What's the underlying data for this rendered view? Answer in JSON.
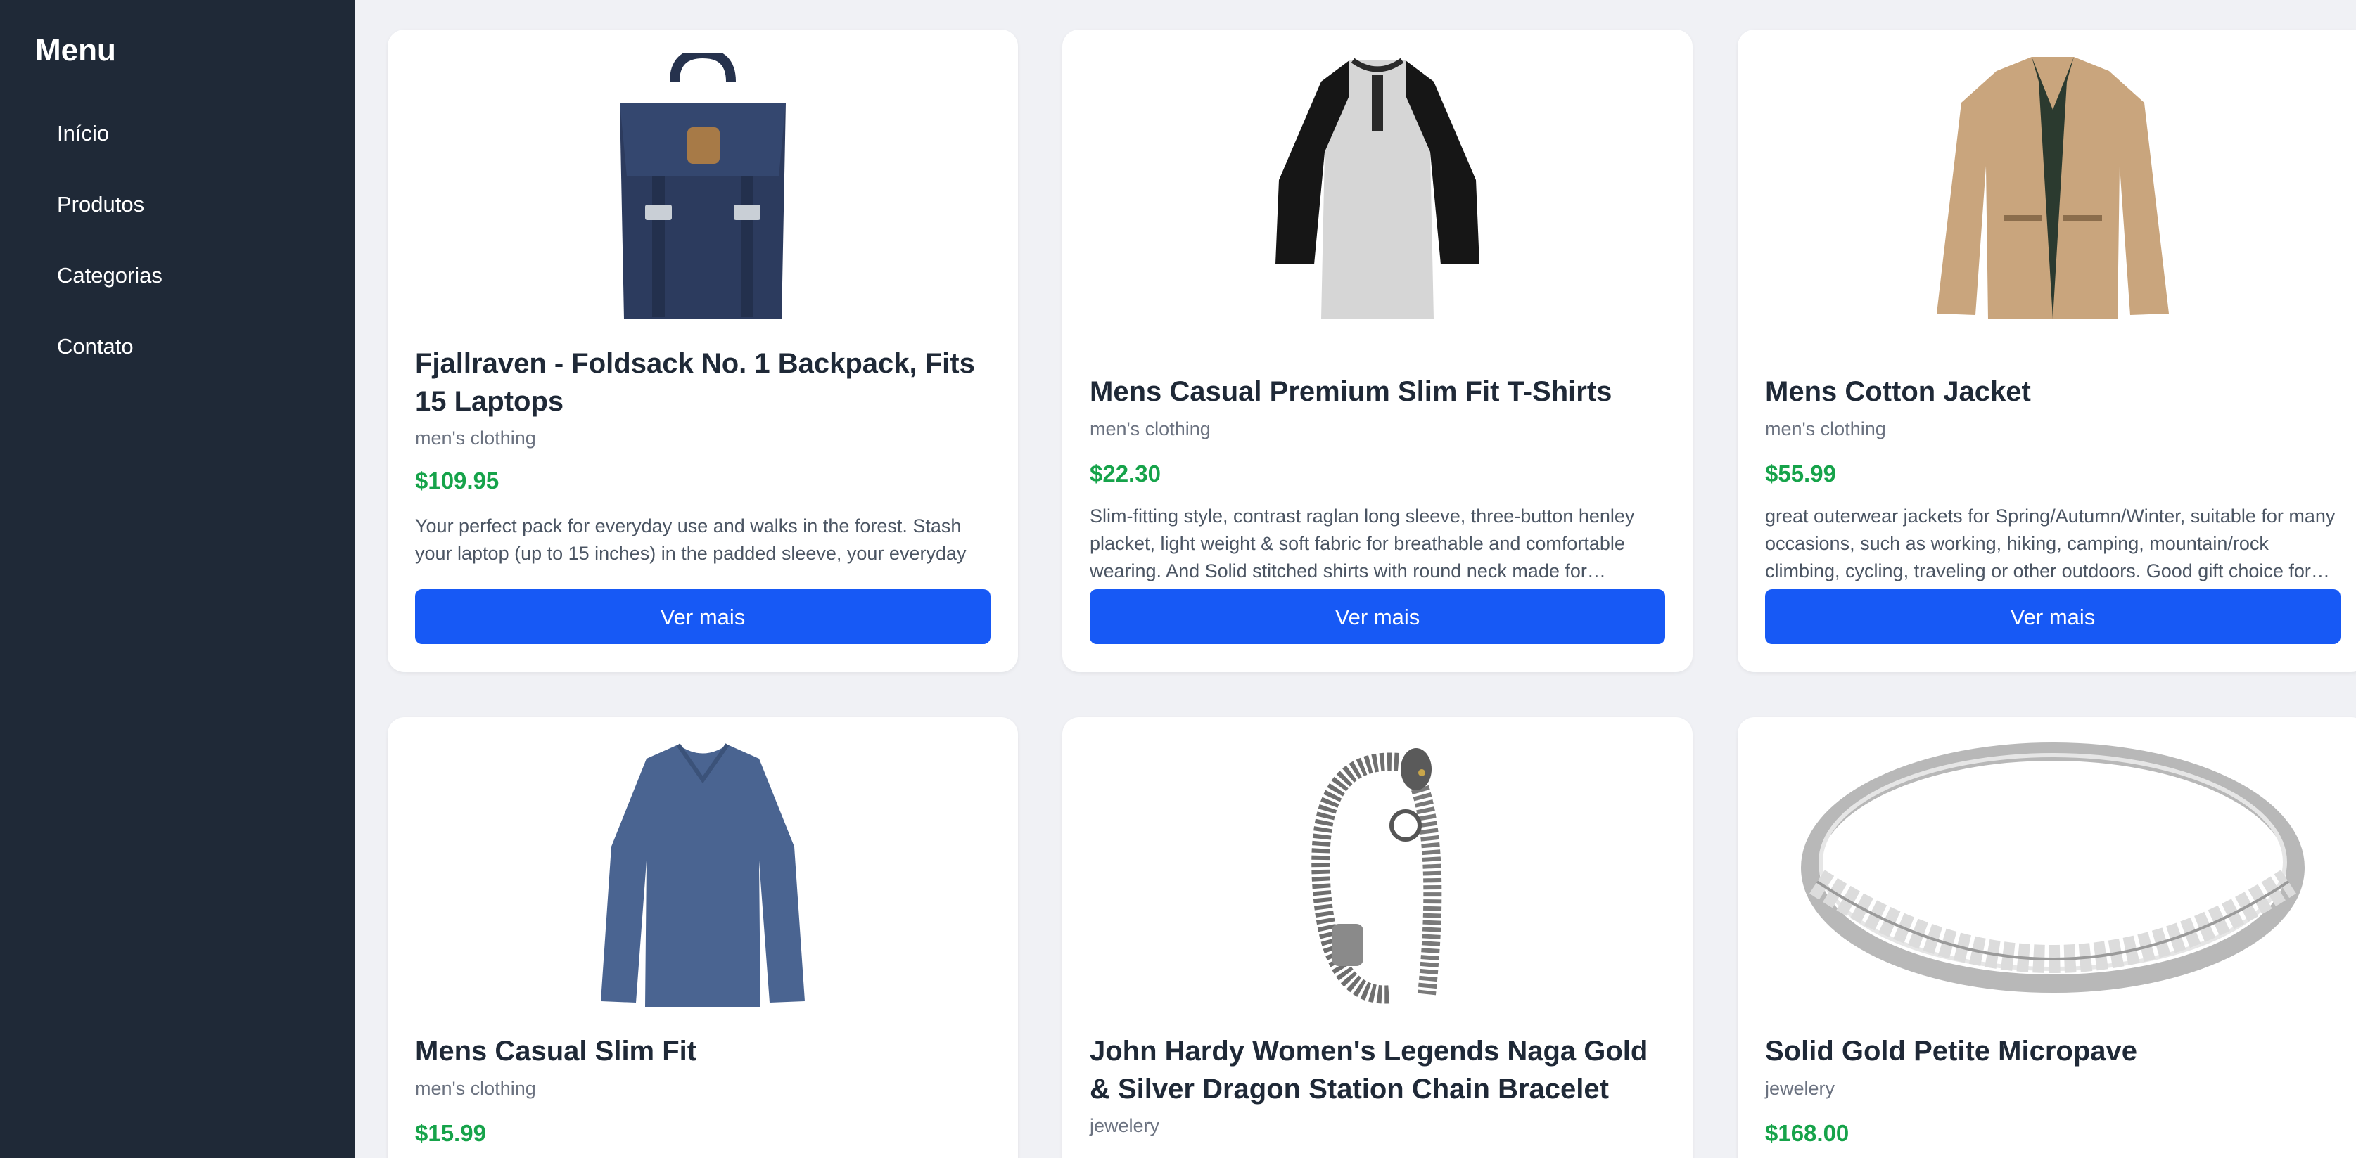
{
  "sidebar": {
    "title": "Menu",
    "items": [
      {
        "label": "Início"
      },
      {
        "label": "Produtos"
      },
      {
        "label": "Categorias"
      },
      {
        "label": "Contato"
      }
    ]
  },
  "products": [
    {
      "title": "Fjallraven - Foldsack No. 1 Backpack, Fits 15 Laptops",
      "category": "men's clothing",
      "price": "$109.95",
      "description": "Your perfect pack for everyday use and walks in the forest. Stash your laptop (up to 15 inches) in the padded sleeve, your everyday",
      "button": "Ver mais",
      "image_icon": "backpack-image"
    },
    {
      "title": "Mens Casual Premium Slim Fit T-Shirts",
      "category": "men's clothing",
      "price": "$22.30",
      "description": "Slim-fitting style, contrast raglan long sleeve, three-button henley placket, light weight & soft fabric for breathable and comfortable wearing. And Solid stitched shirts with round neck made for…",
      "button": "Ver mais",
      "image_icon": "tshirt-image"
    },
    {
      "title": "Mens Cotton Jacket",
      "category": "men's clothing",
      "price": "$55.99",
      "description": "great outerwear jackets for Spring/Autumn/Winter, suitable for many occasions, such as working, hiking, camping, mountain/rock climbing, cycling, traveling or other outdoors. Good gift choice for…",
      "button": "Ver mais",
      "image_icon": "jacket-image"
    },
    {
      "title": "Mens Casual Slim Fit",
      "category": "men's clothing",
      "price": "$15.99",
      "image_icon": "long-sleeve-shirt-image"
    },
    {
      "title": "John Hardy Women's Legends Naga Gold & Silver Dragon Station Chain Bracelet",
      "category": "jewelery",
      "image_icon": "bracelet-image"
    },
    {
      "title": "Solid Gold Petite Micropave",
      "category": "jewelery",
      "price": "$168.00",
      "image_icon": "ring-image"
    }
  ],
  "colors": {
    "sidebar_bg": "#1f2937",
    "page_bg": "#f0f1f5",
    "price": "#16a34a",
    "button": "#1759f5"
  }
}
